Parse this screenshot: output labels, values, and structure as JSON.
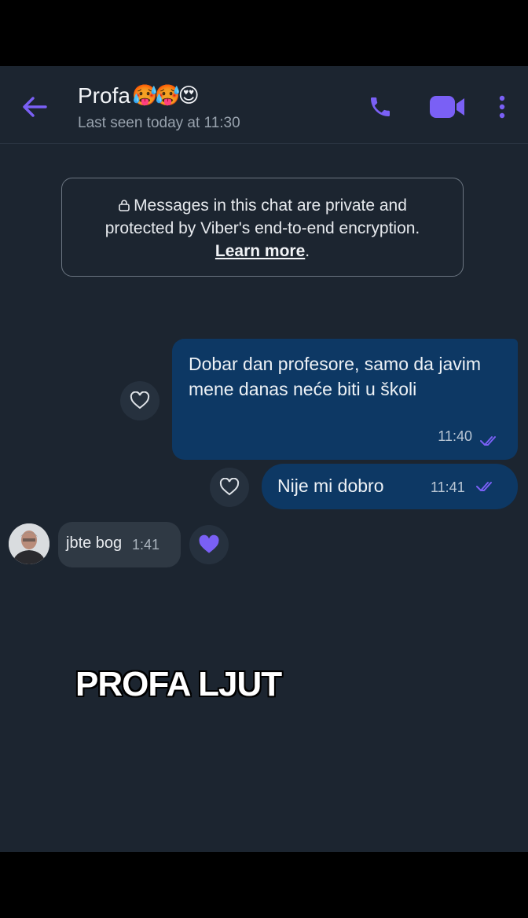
{
  "header": {
    "title": "Profa",
    "title_emojis": "🥵🥵😍",
    "subtitle": "Last seen today at 11:30"
  },
  "icons": {
    "back": "back-arrow-icon",
    "call": "phone-icon",
    "video": "video-camera-icon",
    "menu": "more-vertical-icon",
    "lock": "lock-icon",
    "heart": "heart-icon",
    "read": "double-check-icon"
  },
  "notice": {
    "line1": "Messages in this chat are private and",
    "line2": "protected by Viber's end-to-end encryption.",
    "link": "Learn more",
    "link_suffix": "."
  },
  "messages": [
    {
      "direction": "outgoing",
      "text": "Dobar dan profesore, samo da javim mene danas neće biti u školi",
      "time": "11:40",
      "status": "read"
    },
    {
      "direction": "outgoing",
      "text": "Nije mi dobro",
      "time": "11:41",
      "status": "read"
    },
    {
      "direction": "incoming",
      "text": "jbte bog",
      "time": "1:41",
      "reaction": "heart"
    }
  ],
  "caption": "PROFA LJUT",
  "colors": {
    "accent": "#7a60f5",
    "background": "#1c2530",
    "outgoing_bubble": "#0d3864",
    "incoming_bubble": "#2f3944"
  }
}
